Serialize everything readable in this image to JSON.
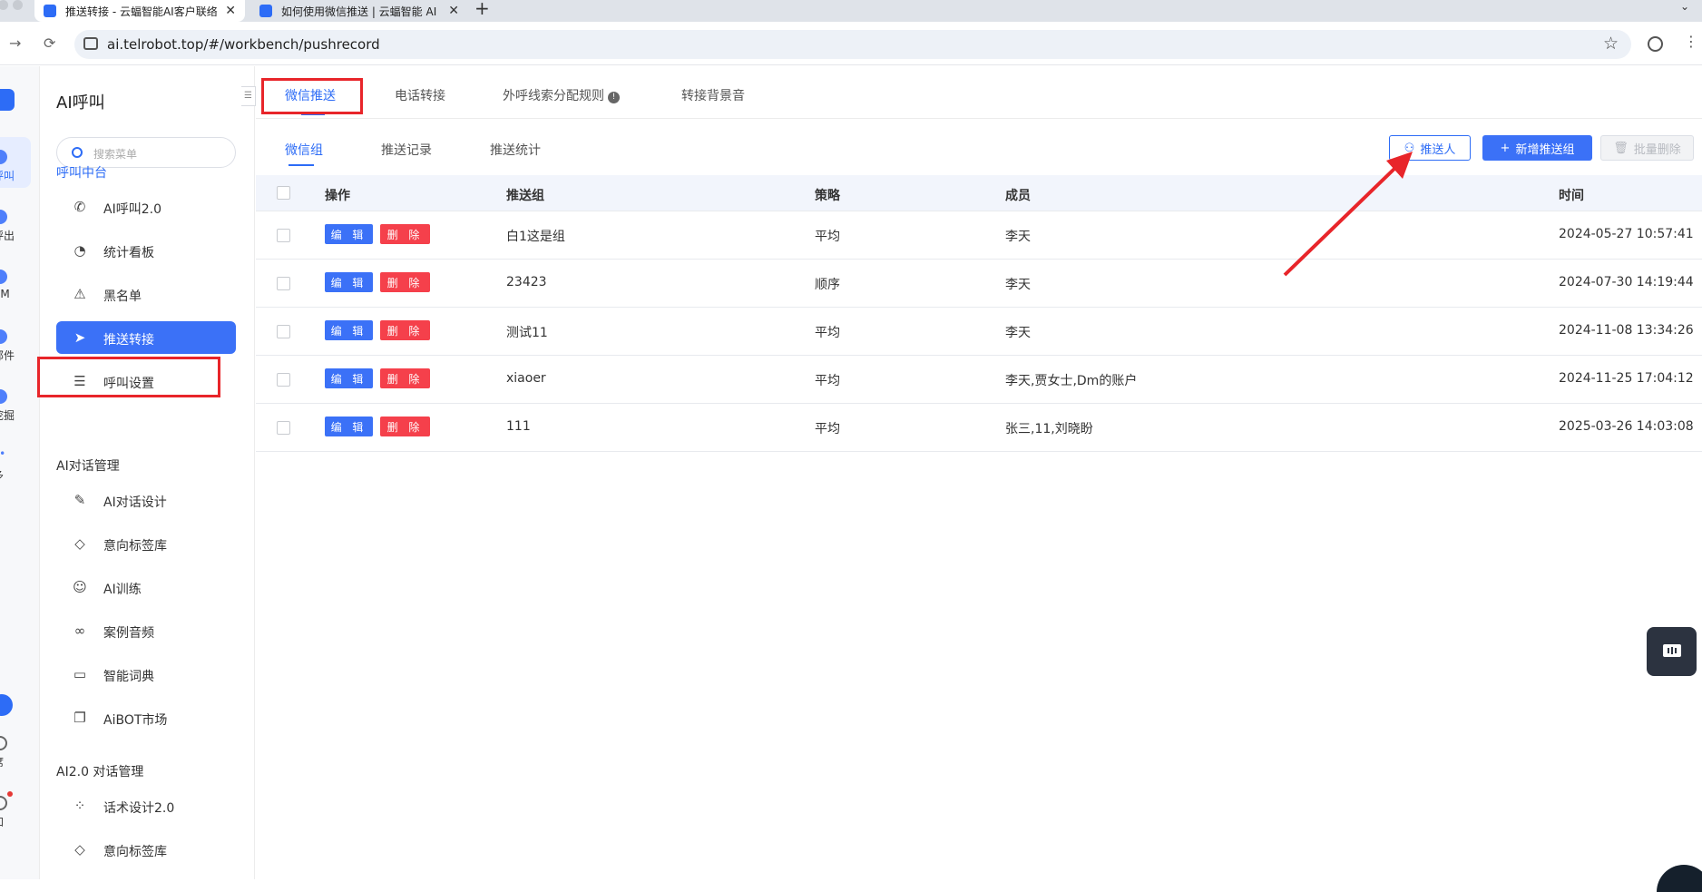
{
  "browser": {
    "tabs": [
      {
        "title": "推送转接 - 云蝠智能AI客户联络",
        "active": true
      },
      {
        "title": "如何使用微信推送 | 云蝠智能 AI",
        "active": false
      }
    ],
    "url": "ai.telrobot.top/#/workbench/pushrecord"
  },
  "rail": {
    "items": [
      {
        "label": "呼叫"
      },
      {
        "label": "呼出"
      },
      {
        "label": "RM"
      },
      {
        "label": "邮件"
      },
      {
        "label": "挖掘"
      },
      {
        "label": "多"
      },
      {
        "label": "席"
      },
      {
        "label": "知"
      }
    ]
  },
  "sidebar": {
    "title": "AI呼叫",
    "search_placeholder": "搜索菜单",
    "groups": [
      {
        "label": "呼叫中台"
      },
      {
        "label": "AI对话管理"
      },
      {
        "label": "AI2.0 对话管理"
      }
    ],
    "items": [
      {
        "label": "AI呼叫2.0",
        "icon": "phone-icon"
      },
      {
        "label": "统计看板",
        "icon": "pie-chart-icon"
      },
      {
        "label": "黑名单",
        "icon": "warning-icon"
      },
      {
        "label": "推送转接",
        "icon": "send-icon"
      },
      {
        "label": "呼叫设置",
        "icon": "sliders-icon"
      },
      {
        "label": "AI对话设计",
        "icon": "pen-icon"
      },
      {
        "label": "意向标签库",
        "icon": "tag-icon"
      },
      {
        "label": "AI训练",
        "icon": "chat-icon"
      },
      {
        "label": "案例音频",
        "icon": "voicemail-icon"
      },
      {
        "label": "智能词典",
        "icon": "book-icon"
      },
      {
        "label": "AiBOT市场",
        "icon": "windows-icon"
      },
      {
        "label": "话术设计2.0",
        "icon": "grid-icon"
      },
      {
        "label": "意向标签库",
        "icon": "tag-icon"
      }
    ]
  },
  "main": {
    "top_tabs": [
      {
        "label": "微信推送"
      },
      {
        "label": "电话转接"
      },
      {
        "label": "外呼线索分配规则"
      },
      {
        "label": "转接背景音"
      }
    ],
    "sub_tabs": [
      {
        "label": "微信组"
      },
      {
        "label": "推送记录"
      },
      {
        "label": "推送统计"
      }
    ],
    "buttons": {
      "pusher": "推送人",
      "add_group": "新增推送组",
      "batch_delete": "批量删除"
    },
    "table": {
      "columns": [
        "操作",
        "推送组",
        "策略",
        "成员",
        "时间"
      ],
      "edit_label": "编 辑",
      "delete_label": "删 除",
      "rows": [
        {
          "group": "白1这是组",
          "strategy": "平均",
          "members": "李天",
          "time": "2024-05-27 10:57:41"
        },
        {
          "group": "23423",
          "strategy": "顺序",
          "members": "李天",
          "time": "2024-07-30 14:19:44"
        },
        {
          "group": "测试11",
          "strategy": "平均",
          "members": "李天",
          "time": "2024-11-08 13:34:26"
        },
        {
          "group": "xiaoer",
          "strategy": "平均",
          "members": "李天,贾女士,Dm的账户",
          "time": "2024-11-25 17:04:12"
        },
        {
          "group": "111",
          "strategy": "平均",
          "members": "张三,11,刘晓盼",
          "time": "2025-03-26 14:03:08"
        }
      ]
    }
  },
  "colors": {
    "accent": "#2d6cf6",
    "danger": "#f5404b",
    "annotation": "#e8252a"
  }
}
